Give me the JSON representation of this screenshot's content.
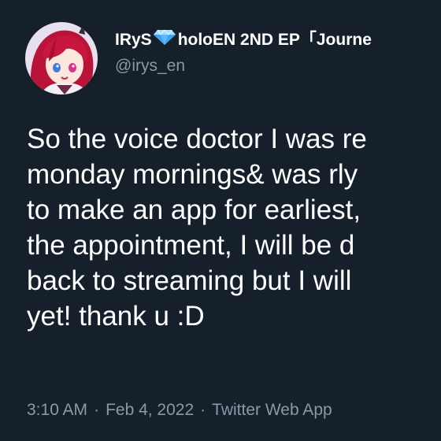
{
  "tweet": {
    "display_name_prefix": "IRyS",
    "display_name_gem_icon": "gem-icon",
    "display_name_suffix": "holoEN 2ND EP「Journe",
    "handle": "@irys_en",
    "body_lines": [
      "So the voice doctor I was re",
      "monday mornings& was rly",
      "to make an app for earliest,",
      "the appointment, I will be d",
      "back to streaming but I will",
      "yet! thank u :D"
    ],
    "time": "3:10 AM",
    "date": "Feb 4, 2022",
    "source": "Twitter Web App",
    "separator": "·"
  },
  "colors": {
    "background": "#15202b",
    "text": "#ffffff",
    "secondary_text": "#8b98a5",
    "gem": "#6fc3ff"
  }
}
